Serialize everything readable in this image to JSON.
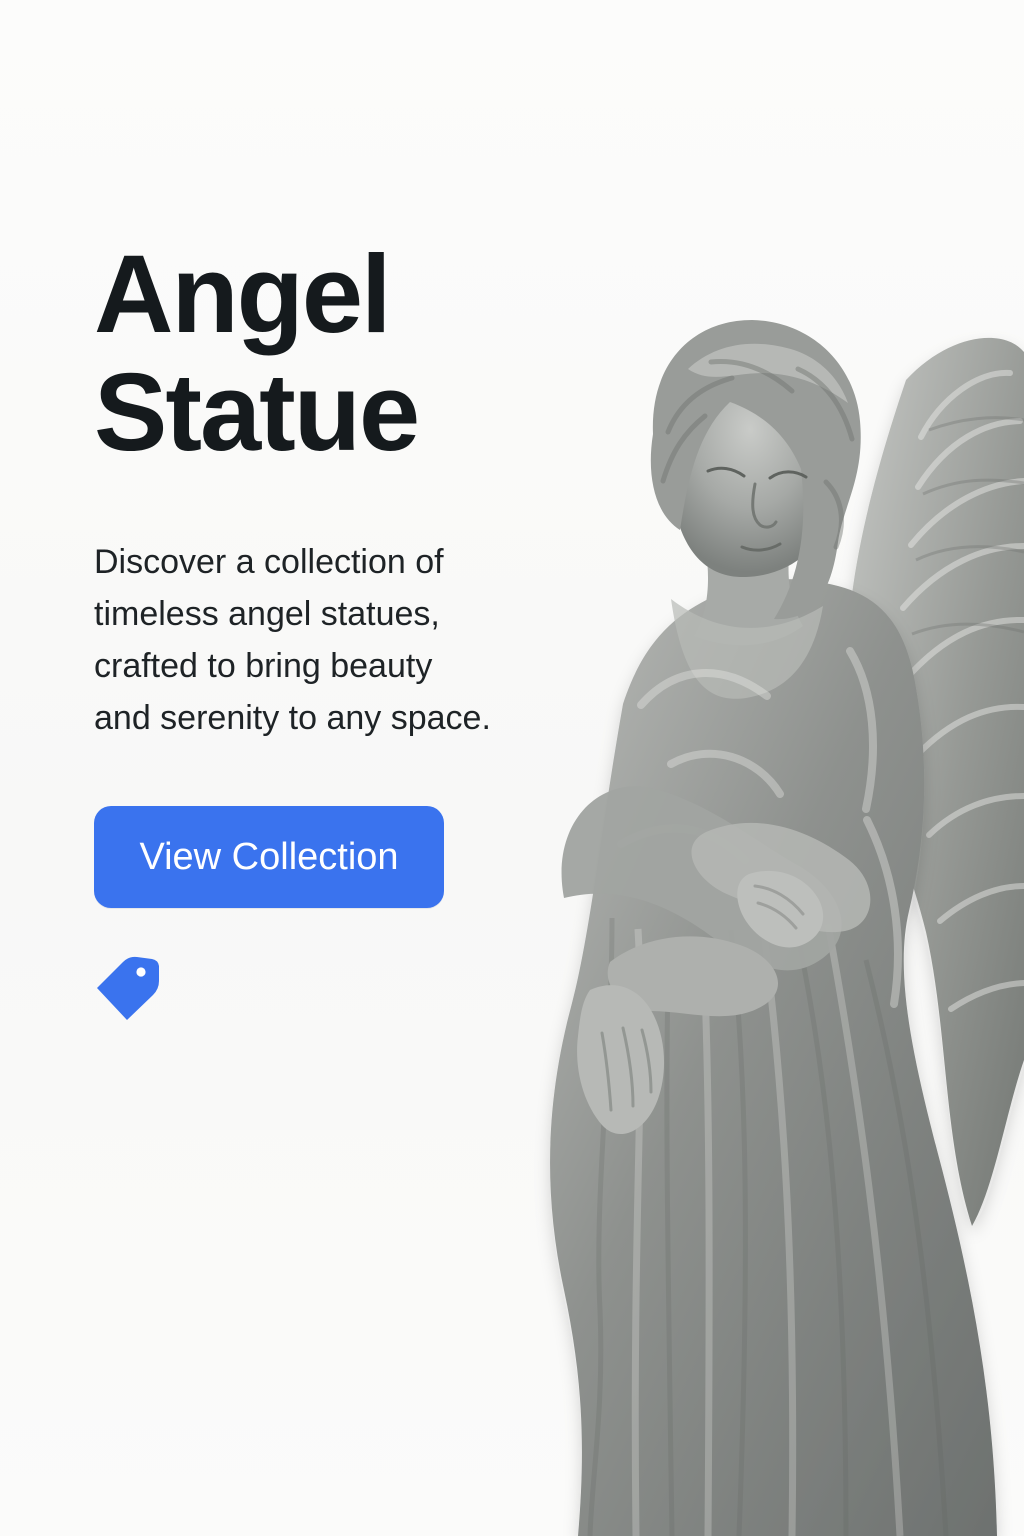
{
  "hero": {
    "title_line_1": "Angel",
    "title_line_2": "Statue",
    "description_lines": [
      "Discover a collection of",
      "timeless angel statues,",
      "crafted to bring beauty",
      "and serenity to any space."
    ],
    "cta_label": "View Collection",
    "tag_icon": "price-tag-icon",
    "statue_image": "angel-statue-image"
  },
  "colors": {
    "background": "#fbfbfa",
    "title": "#151a1d",
    "body_text": "#1e2326",
    "accent": "#3a73ee",
    "stone": "#8c8f8c"
  }
}
